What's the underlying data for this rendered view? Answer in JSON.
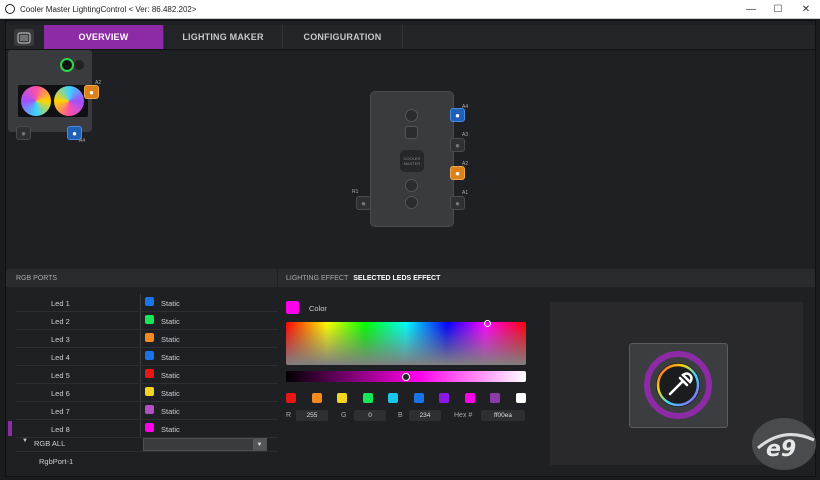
{
  "window": {
    "title": "Cooler Master LightingControl < Ver: 86.482.202>"
  },
  "tabs": [
    {
      "label": "OVERVIEW",
      "active": true
    },
    {
      "label": "LIGHTING MAKER",
      "active": false
    },
    {
      "label": "CONFIGURATION",
      "active": false
    }
  ],
  "device": {
    "ports": [
      {
        "id": "A2",
        "label": "A2",
        "color": "#d9821c"
      },
      {
        "id": "A4",
        "label": "A4",
        "color": "#1f5fb5"
      }
    ]
  },
  "controller": {
    "ports_right": [
      {
        "label": "A4",
        "color": "#1f5fb5"
      },
      {
        "label": "A3",
        "color": "#2f3033"
      },
      {
        "label": "A2",
        "color": "#d9821c"
      },
      {
        "label": "A1",
        "color": "#2f3033"
      }
    ],
    "port_left": {
      "label": "R1"
    }
  },
  "rgb_ports": {
    "title": "RGB PORTS",
    "leds": [
      {
        "name": "Led 1",
        "color": "#1a73e8",
        "effect": "Static"
      },
      {
        "name": "Led 2",
        "color": "#17e85a",
        "effect": "Static"
      },
      {
        "name": "Led 3",
        "color": "#f58a1f",
        "effect": "Static"
      },
      {
        "name": "Led 4",
        "color": "#1a73e8",
        "effect": "Static"
      },
      {
        "name": "Led 5",
        "color": "#e81717",
        "effect": "Static"
      },
      {
        "name": "Led 6",
        "color": "#f5d51f",
        "effect": "Static"
      },
      {
        "name": "Led 7",
        "color": "#b34fc4",
        "effect": "Static"
      },
      {
        "name": "Led 8",
        "color": "#ff00ea",
        "effect": "Static"
      }
    ],
    "rgb_all": "RGB ALL",
    "rgb_port_1": "RgbPort-1"
  },
  "lighting": {
    "header_label": "LIGHTING EFFECT",
    "header_selected": "SELECTED LEDS EFFECT",
    "color_label": "Color",
    "current_color": "#ff00ea",
    "brightness_fraction": 0.5,
    "presets": [
      "#e81717",
      "#f58a1f",
      "#f5d51f",
      "#17e85a",
      "#17c6e8",
      "#1a73e8",
      "#8d17e8",
      "#ff00ea",
      "#8d3aa6",
      "#ffffff"
    ],
    "r_label": "R",
    "r": "255",
    "g_label": "G",
    "g": "0",
    "b_label": "B",
    "b": "234",
    "hex_label": "Hex #",
    "hex": "ff00ea"
  }
}
